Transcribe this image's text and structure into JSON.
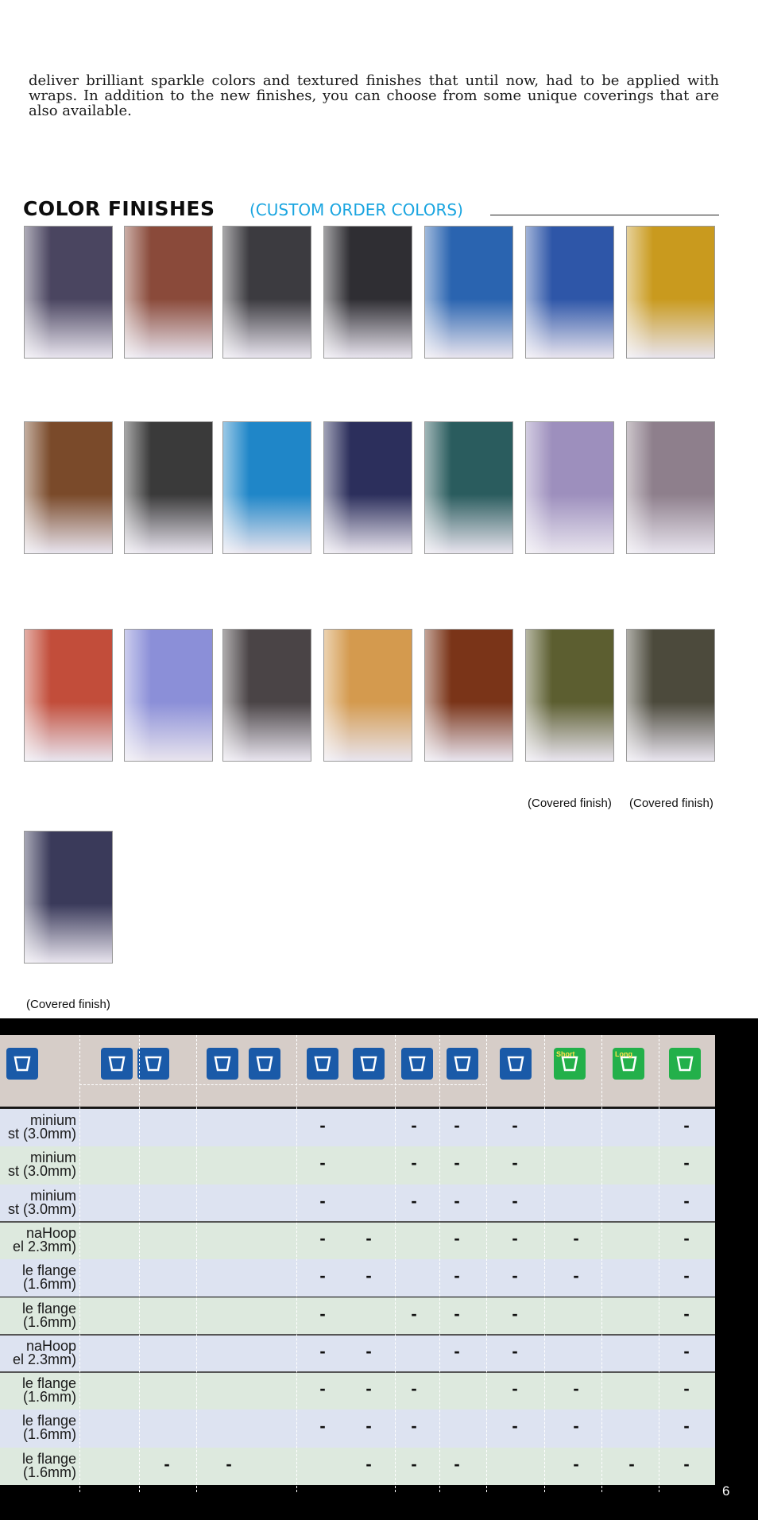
{
  "intro": {
    "text": "deliver brilliant sparkle colors and textured finishes that until now, had to be applied with wraps. In addition to the new finishes, you can choose from some unique coverings that are also available."
  },
  "heading": {
    "title": "COLOR FINISHES",
    "subtitle": "(CUSTOM ORDER COLORS)"
  },
  "captions": {
    "covered_1": "(Covered finish)",
    "covered_2": "(Covered finish)",
    "covered_3": "(Covered finish)"
  },
  "swatches": {
    "row1": [
      "#4a4560",
      "#8a4a3a",
      "#3c3b40",
      "#2f2e33",
      "#2a64b0",
      "#2e56a8",
      "#c99a1e"
    ],
    "row2": [
      "#7a4a2a",
      "#3a3a3a",
      "#1f86c8",
      "#2c2f5c",
      "#2a5c5e",
      "#9d8fbd",
      "#8e7f8c"
    ],
    "row3": [
      "#c24d3a",
      "#8b8fd8",
      "#4a4446",
      "#d49a4e",
      "#7a3418",
      "#5c5e30",
      "#4c4a3c"
    ],
    "row4": [
      "#3a3a5a"
    ]
  },
  "table": {
    "header_icons": [
      {
        "name": "ledge-icon",
        "label": ""
      },
      {
        "name": "snare-mount-icon",
        "label": ""
      },
      {
        "name": "tom-mount-icon",
        "label": ""
      },
      {
        "name": "drum-shell-icon",
        "label": ""
      },
      {
        "name": "drum-shell-flat-icon",
        "label": ""
      },
      {
        "name": "hoop-curve-icon",
        "label": ""
      },
      {
        "name": "hoop-curve-2-icon",
        "label": ""
      },
      {
        "name": "hoop-straight-icon",
        "label": ""
      },
      {
        "name": "hoop-straight-2-icon",
        "label": ""
      },
      {
        "name": "depth-icon",
        "label": ""
      },
      {
        "name": "short-lug-icon",
        "label": "Short"
      },
      {
        "name": "long-lug-icon",
        "label": "Long"
      },
      {
        "name": "tripod-icon",
        "label": ""
      }
    ],
    "rows": [
      {
        "line1": "minium",
        "line2": "st (3.0mm)",
        "marks": [
          0,
          0,
          0,
          1,
          0,
          1,
          1,
          1,
          0,
          0,
          1,
          0
        ]
      },
      {
        "line1": "minium",
        "line2": "st (3.0mm)",
        "marks": [
          0,
          0,
          0,
          1,
          0,
          1,
          1,
          1,
          0,
          0,
          1,
          0
        ]
      },
      {
        "line1": "minium",
        "line2": "st (3.0mm)",
        "marks": [
          0,
          0,
          0,
          1,
          0,
          1,
          1,
          1,
          0,
          0,
          1,
          0
        ]
      },
      {
        "line1": "naHoop",
        "line2": "el 2.3mm)",
        "marks": [
          0,
          0,
          0,
          1,
          1,
          0,
          1,
          1,
          1,
          0,
          1,
          0
        ]
      },
      {
        "line1": "le flange",
        "line2": "(1.6mm)",
        "marks": [
          0,
          0,
          0,
          1,
          1,
          0,
          1,
          1,
          1,
          0,
          1,
          0
        ]
      },
      {
        "line1": "le flange",
        "line2": "(1.6mm)",
        "marks": [
          0,
          0,
          0,
          1,
          0,
          1,
          1,
          1,
          0,
          0,
          1,
          0
        ]
      },
      {
        "line1": "naHoop",
        "line2": "el 2.3mm)",
        "marks": [
          0,
          0,
          0,
          1,
          1,
          0,
          1,
          1,
          0,
          0,
          1,
          0
        ]
      },
      {
        "line1": "le flange",
        "line2": "(1.6mm)",
        "marks": [
          0,
          0,
          0,
          1,
          1,
          1,
          0,
          1,
          1,
          0,
          1,
          0
        ]
      },
      {
        "line1": "le flange",
        "line2": "(1.6mm)",
        "marks": [
          0,
          0,
          0,
          1,
          1,
          1,
          0,
          1,
          1,
          0,
          1,
          0
        ]
      },
      {
        "line1": "le flange",
        "line2": "(1.6mm)",
        "marks": [
          1,
          1,
          0,
          0,
          1,
          1,
          1,
          0,
          1,
          1,
          0,
          1
        ]
      }
    ],
    "dash_symbol": "-"
  },
  "page_number": "6"
}
